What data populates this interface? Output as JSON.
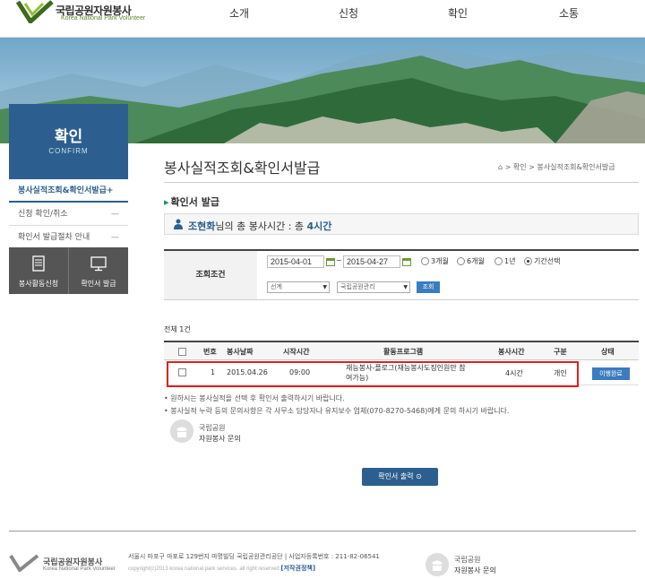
{
  "header": {
    "logo_title": "국립공원자원봉사",
    "logo_sub": "Korea National Park Volunteer",
    "nav": [
      "소개",
      "신청",
      "확인",
      "소통"
    ]
  },
  "sidebar": {
    "title": "확인",
    "title_en": "CONFIRM",
    "items": [
      {
        "label": "봉사실적조회&확인서발급+",
        "active": true
      },
      {
        "label": "신청 확인/취소",
        "dash": "—"
      },
      {
        "label": "확인서 발급절차 안내",
        "dash": "—"
      }
    ],
    "quick": [
      {
        "label": "봉사활동신청",
        "icon": "document-icon"
      },
      {
        "label": "확인서 발급",
        "icon": "monitor-icon"
      }
    ]
  },
  "content": {
    "page_title": "봉사실적조회&확인서발급",
    "breadcrumb": "> 확인 > 봉사실적조회&확인서발급",
    "section_title": "확인서 발급",
    "summary": {
      "name": "조현화",
      "text": "님의 총 봉사시간 : 총",
      "hours": "4시간"
    },
    "filter": {
      "label": "조회조건",
      "start_date": "2015-04-01",
      "end_date": "2015-04-27",
      "tilde": "~",
      "radios": [
        {
          "label": "3개월",
          "checked": false
        },
        {
          "label": "6개월",
          "checked": false
        },
        {
          "label": "1년",
          "checked": false
        },
        {
          "label": "기간선택",
          "checked": true
        }
      ],
      "select1": "선계",
      "select2": "국립공원관리",
      "search_label": "조회"
    },
    "count": "전체 1건",
    "table": {
      "headers": [
        "번호",
        "봉사날짜",
        "시작시간",
        "활동프로그램",
        "봉사시간",
        "구분",
        "상태"
      ],
      "rows": [
        {
          "no": "1",
          "date": "2015.04.26",
          "start": "09:00",
          "program_line1": "재능봉사-플로그(재능봉사도징인원만 참",
          "program_line2": "여가능)",
          "hours": "4시간",
          "type": "개인",
          "status": "이행완료"
        }
      ]
    },
    "notes": [
      "• 원하시는 봉사실적을 선택 후 확인서 출력하시기 바랍니다.",
      "• 봉사실적 누락 등의 문의사항은 각 사무소 담당자나 유지보수 업체(070-8270-5468)에게 문의 하시기 바랍니다."
    ],
    "inquiry": {
      "line1": "국립공원",
      "line2": "자원봉사 문의"
    },
    "print_label": "확인서 출력 ⊙"
  },
  "footer": {
    "logo_title": "국립공원자원봉사",
    "logo_sub": "Korea National Park Volunteer",
    "address": "서울시 마포구 마포로 129번지 마명빌딩 국립공원관리공단  |  사업자등록번호 : 211-82-06541",
    "copyright": "copyright(c)2013 korea national park services. all right reserved",
    "privacy": "[저작권정책]",
    "inquiry": {
      "line1": "국립공원",
      "line2": "자원봉사 문의"
    }
  },
  "colors": {
    "accent": "#2c5f8f",
    "button": "#3a7cc0",
    "highlight": "#e02020"
  }
}
